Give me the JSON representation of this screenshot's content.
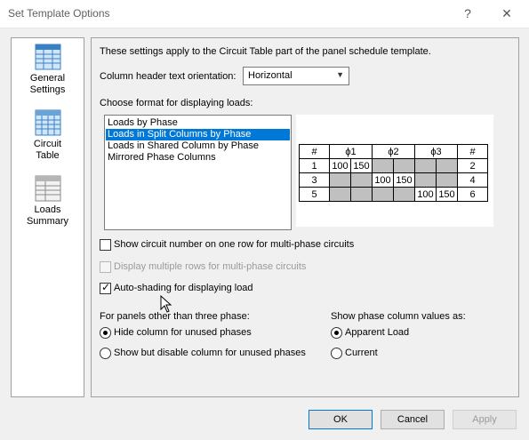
{
  "window": {
    "title": "Set Template Options",
    "help_label": "?",
    "close_label": "✕"
  },
  "sidebar": {
    "items": [
      {
        "label": "General\nSettings",
        "icon": "general-settings-icon"
      },
      {
        "label": "Circuit\nTable",
        "icon": "circuit-table-icon"
      },
      {
        "label": "Loads\nSummary",
        "icon": "loads-summary-icon"
      }
    ]
  },
  "main": {
    "intro": "These settings apply to the Circuit Table part of the panel schedule template.",
    "orientation_label": "Column header text orientation:",
    "orientation_value": "Horizontal",
    "format_label": "Choose format for displaying loads:",
    "format_options": [
      "Loads by Phase",
      "Loads in Split Columns by Phase",
      "Loads in Shared Column by Phase",
      "Mirrored Phase Columns"
    ],
    "selected_format": "Loads in Split Columns by Phase",
    "preview": {
      "header": [
        "#",
        "ϕ1",
        "ϕ2",
        "ϕ3",
        "#"
      ],
      "rows": [
        {
          "left": "1",
          "vals": [
            "100",
            "150",
            "",
            "",
            "",
            ""
          ],
          "right": "2"
        },
        {
          "left": "3",
          "vals": [
            "",
            "",
            "100",
            "150",
            "",
            ""
          ],
          "right": "4"
        },
        {
          "left": "5",
          "vals": [
            "",
            "",
            "",
            "",
            "100",
            "150"
          ],
          "right": "6"
        }
      ]
    },
    "checkboxes": {
      "circuit_one_row": {
        "label": "Show circuit number on one row for multi-phase circuits",
        "checked": false
      },
      "multiple_rows": {
        "label": "Display multiple rows for multi-phase circuits",
        "checked": false,
        "disabled": true
      },
      "auto_shading": {
        "label": "Auto-shading for displaying load",
        "checked": true
      }
    },
    "other_phase": {
      "label": "For panels other than three phase:",
      "options": [
        "Hide column for unused phases",
        "Show but disable column for unused phases"
      ],
      "selected": "Hide column for unused phases"
    },
    "phase_values": {
      "label": "Show phase column values as:",
      "options": [
        "Apparent Load",
        "Current"
      ],
      "selected": "Apparent Load"
    }
  },
  "buttons": {
    "ok": "OK",
    "cancel": "Cancel",
    "apply": "Apply"
  },
  "colors": {
    "selection": "#0078d7",
    "shade": "#c0c0c0",
    "panel_border": "#a0a0a0"
  }
}
